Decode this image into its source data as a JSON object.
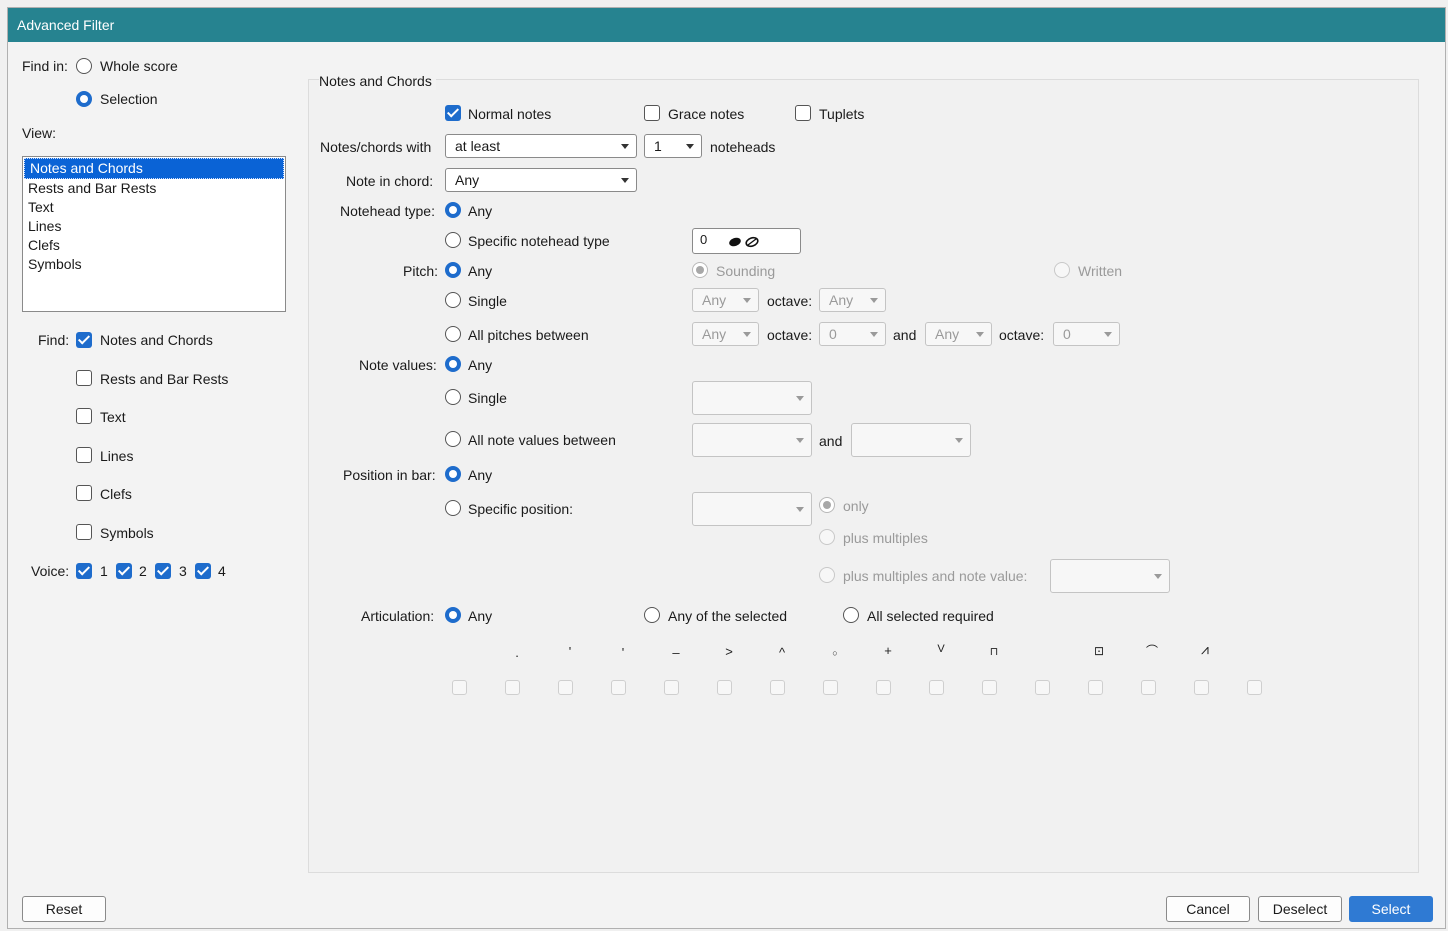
{
  "window": {
    "title": "Advanced Filter"
  },
  "left": {
    "find_in_label": "Find in:",
    "whole_score": "Whole score",
    "selection": "Selection",
    "view_label": "View:",
    "view_items": [
      "Notes and Chords",
      "Rests and Bar Rests",
      "Text",
      "Lines",
      "Clefs",
      "Symbols"
    ],
    "find_label": "Find:",
    "find_items": [
      "Notes and Chords",
      "Rests and Bar Rests",
      "Text",
      "Lines",
      "Clefs",
      "Symbols"
    ],
    "voice_label": "Voice:",
    "voices": [
      "1",
      "2",
      "3",
      "4"
    ]
  },
  "group": {
    "title": "Notes and Chords",
    "normal_notes": "Normal notes",
    "grace_notes": "Grace notes",
    "tuplets": "Tuplets",
    "notes_chords_with": "Notes/chords with",
    "at_least": "at least",
    "count": "1",
    "noteheads": "noteheads",
    "note_in_chord": "Note in chord:",
    "any": "Any",
    "notehead_type": "Notehead type:",
    "specific_notehead": "Specific notehead type",
    "notehead_value": "0",
    "pitch": "Pitch:",
    "sounding": "Sounding",
    "written": "Written",
    "single": "Single",
    "octave": "octave:",
    "all_pitches_between": "All pitches between",
    "zero": "0",
    "and": "and",
    "note_values": "Note values:",
    "all_note_values_between": "All note values between",
    "position_in_bar": "Position in bar:",
    "specific_position": "Specific position:",
    "only": "only",
    "plus_multiples": "plus multiples",
    "plus_multiples_note_value": "plus multiples and note value:",
    "articulation": "Articulation:",
    "any_of_selected": "Any of the selected",
    "all_selected_required": "All selected required",
    "art_symbols": [
      ".",
      "'",
      "'",
      "–",
      ">",
      "^",
      "○",
      "+",
      "V",
      "⊓",
      "",
      "",
      "⊡",
      "⌒",
      "⩘",
      ""
    ]
  },
  "buttons": {
    "reset": "Reset",
    "cancel": "Cancel",
    "deselect": "Deselect",
    "select": "Select"
  },
  "colors": {
    "titlebar": "#268390",
    "accent": "#1e6ccc",
    "primary_button": "#2f7ad3"
  }
}
